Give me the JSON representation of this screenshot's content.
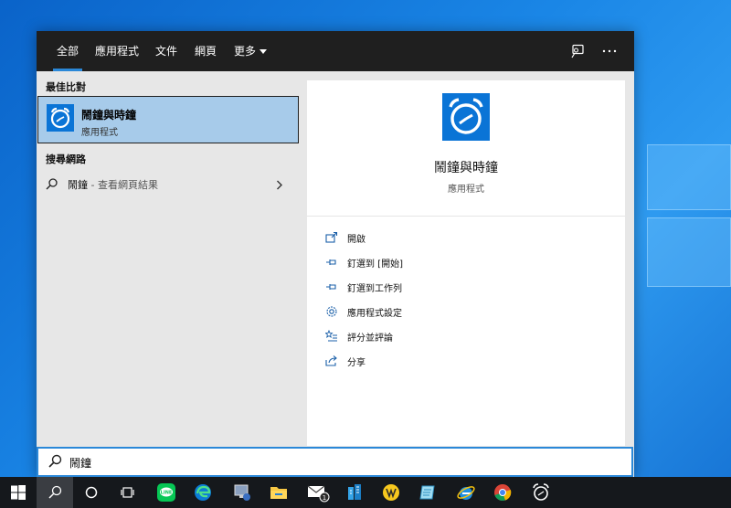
{
  "tabs": [
    {
      "label": "全部",
      "active": true
    },
    {
      "label": "應用程式"
    },
    {
      "label": "文件"
    },
    {
      "label": "網頁"
    },
    {
      "label": "更多"
    }
  ],
  "left": {
    "best_match_title": "最佳比對",
    "best_match": {
      "title": "鬧鐘與時鐘",
      "subtitle": "應用程式"
    },
    "web_title": "搜尋網路",
    "web_result": {
      "query": "鬧鐘",
      "suffix": " - 查看網頁結果"
    }
  },
  "detail": {
    "title": "鬧鐘與時鐘",
    "subtitle": "應用程式",
    "actions": [
      {
        "label": "開啟",
        "icon": "open-icon"
      },
      {
        "label": "釘選到 [開始]",
        "icon": "pin-icon"
      },
      {
        "label": "釘選到工作列",
        "icon": "pin-icon"
      },
      {
        "label": "應用程式設定",
        "icon": "gear-icon"
      },
      {
        "label": "評分並評論",
        "icon": "star-list-icon"
      },
      {
        "label": "分享",
        "icon": "share-icon"
      }
    ]
  },
  "search": {
    "value": "鬧鐘"
  },
  "colors": {
    "accent": "#2b88d8",
    "selection": "#a7cbea",
    "app_tile": "#0a74d6",
    "topbar": "#1f1f1f",
    "taskbar": "#15181c"
  },
  "taskbar": {
    "items": [
      "start-icon",
      "search-icon",
      "cortana-icon",
      "task-view-icon",
      "line-icon",
      "edge-icon",
      "network-admin-icon",
      "file-explorer-icon",
      "mail-icon",
      "building-icon",
      "yahoo-kimo-icon",
      "notepad-icon",
      "ie-icon",
      "chrome-icon",
      "alarms-icon"
    ],
    "mail_badge": "1"
  }
}
